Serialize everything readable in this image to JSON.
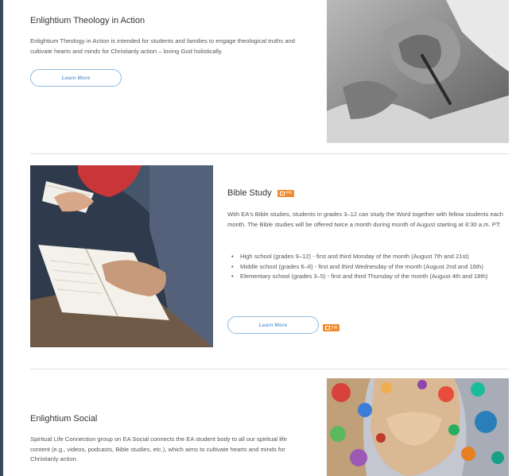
{
  "theology": {
    "title": "Enlightium Theology in Action",
    "desc": "Enlightium Theology in Action is intended for students and families to engage theological truths and cultivate hearts and minds for Christianly action – loving God holistically.",
    "button": "Learn More"
  },
  "bible": {
    "title": "Bible Study",
    "badge": "FR",
    "desc": "With EA's Bible studies, students in grades 3–12 can study the Word together with fellow students each month. The Bible studies will be offered twice a month during month of August starting at 8:30 a.m. PT:",
    "items": [
      "High school (grades 9–12) - first and third Monday of the month (August 7th and 21st)",
      "Middle school (grades 6–8) - first and third Wednesday of the month (August 2nd and 16th)",
      "Elementary school (grades 3–5) - first and third Thursday of the month (August 4th and 18th)"
    ],
    "button": "Learn More",
    "button_badge": "FR"
  },
  "social": {
    "title": "Enlightium Social",
    "desc": "Spiritual Life Connection group on EA Social connects the EA student body to all our spiritual life content (e.g., videos, podcasts, Bible studies, etc.), which aims to cultivate hearts and minds for Christianly action."
  },
  "colors": {
    "button_border": "#8fbbe0",
    "button_text": "#6ea5d8",
    "badge": "#f28a2e"
  }
}
